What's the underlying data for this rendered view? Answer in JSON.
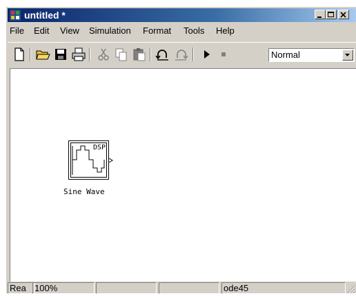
{
  "window": {
    "title": "untitled *",
    "icon": "simulink-model-icon",
    "buttons": [
      "minimize-icon",
      "maximize-icon",
      "close-icon"
    ]
  },
  "menubar": {
    "items": [
      {
        "label": "File"
      },
      {
        "label": "Edit"
      },
      {
        "label": "View"
      },
      {
        "label": "Simulation"
      },
      {
        "label": "Format"
      },
      {
        "label": "Tools"
      },
      {
        "label": "Help"
      }
    ]
  },
  "toolbar": {
    "buttons": [
      "new-icon",
      "open-icon",
      "save-icon",
      "print-icon",
      "cut-icon",
      "copy-icon",
      "paste-icon",
      "undo-icon",
      "redo-icon",
      "play-icon",
      "stop-icon"
    ],
    "mode_select": {
      "value": "Normal"
    }
  },
  "canvas": {
    "block": {
      "label": "Sine Wave",
      "icon_text": "DSP"
    }
  },
  "statusbar": {
    "ready": "Rea",
    "zoom": "100%",
    "solver": "ode45"
  },
  "colors": {
    "title_gradient_start": "#0a246a",
    "title_gradient_end": "#a6caf0",
    "chrome": "#d4d0c8",
    "canvas": "#ffffff"
  }
}
